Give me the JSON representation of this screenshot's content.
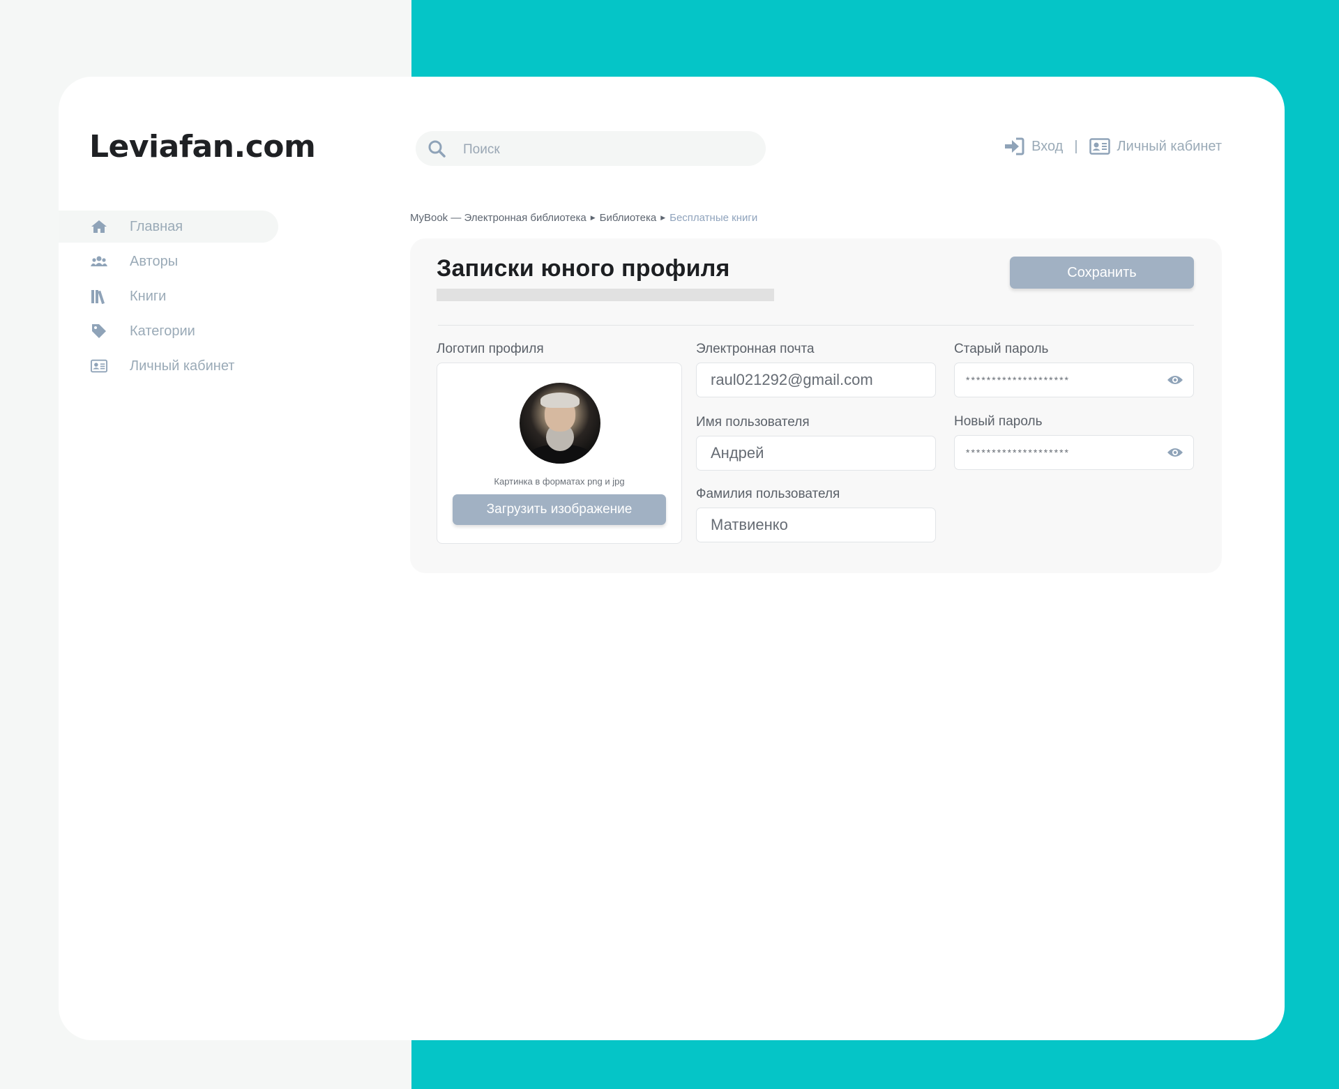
{
  "brand": {
    "logo": "Leviafan.com"
  },
  "search": {
    "placeholder": "Поиск"
  },
  "header": {
    "login": "Вход",
    "separator": "|",
    "cabinet": "Личный кабинет"
  },
  "sidebar": {
    "items": [
      {
        "label": "Главная",
        "icon": "home-icon",
        "active": true
      },
      {
        "label": "Авторы",
        "icon": "users-icon",
        "active": false
      },
      {
        "label": "Книги",
        "icon": "books-icon",
        "active": false
      },
      {
        "label": "Категории",
        "icon": "tag-icon",
        "active": false
      },
      {
        "label": "Личный кабинет",
        "icon": "id-card-icon",
        "active": false
      }
    ]
  },
  "breadcrumb": {
    "items": [
      "MyBook — Электронная библиотека",
      "Библиотека"
    ],
    "current": "Бесплатные книги"
  },
  "profile": {
    "title": "Записки юного профиля",
    "save_label": "Сохранить",
    "logo_label": "Логотип профиля",
    "logo_hint": "Картинка в форматах png и jpg",
    "upload_label": "Загрузить  изображение",
    "email_label": "Электронная почта",
    "email_value": "raul021292@gmail.com",
    "first_name_label": "Имя  пользователя",
    "first_name_value": "Андрей",
    "last_name_label": "Фамилия пользователя",
    "last_name_value": "Матвиенко",
    "old_password_label": "Старый пароль",
    "old_password_value": "********************",
    "new_password_label": "Новый пароль",
    "new_password_value": "********************"
  },
  "colors": {
    "teal": "#05c5c7",
    "accent_button": "#a1b1c3",
    "muted_text": "#9aaab7"
  }
}
